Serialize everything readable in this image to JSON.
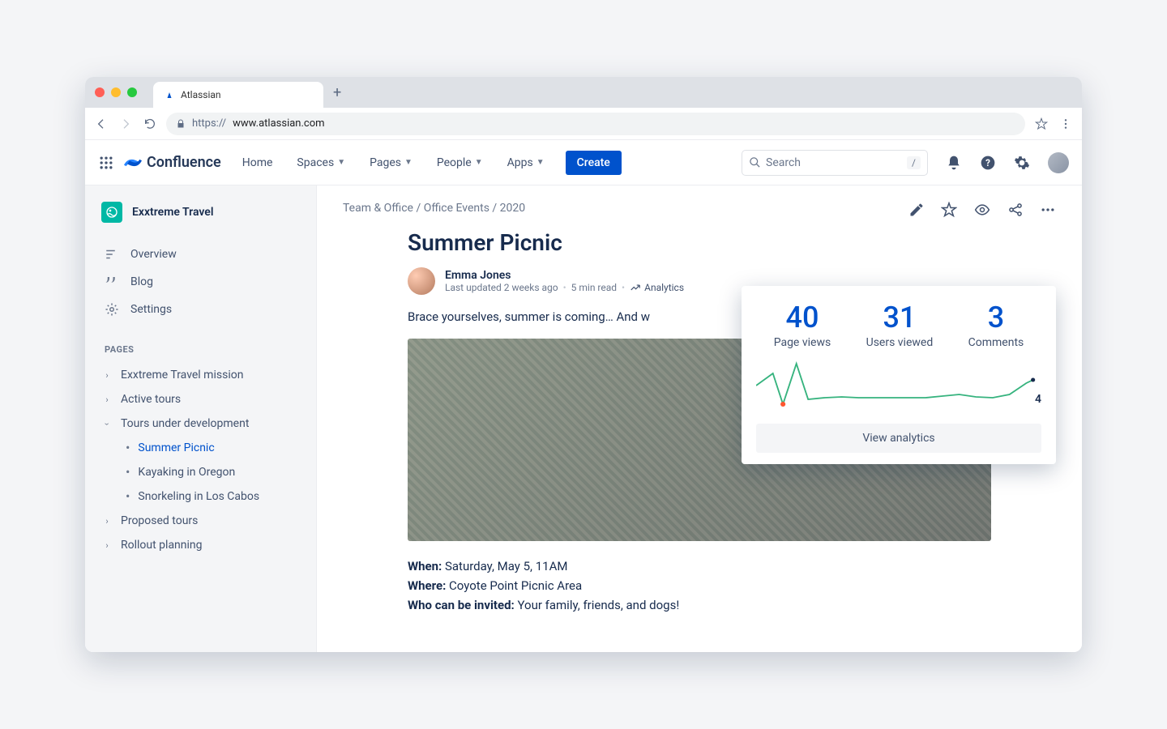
{
  "browser": {
    "tab_title": "Atlassian",
    "url_prefix": "https:// ",
    "url_domain": "www.atlassian.com"
  },
  "header": {
    "product": "Confluence",
    "nav": {
      "home": "Home",
      "spaces": "Spaces",
      "pages": "Pages",
      "people": "People",
      "apps": "Apps"
    },
    "create": "Create",
    "search_placeholder": "Search",
    "search_key": "/"
  },
  "sidebar": {
    "space": "Exxtreme Travel",
    "links": {
      "overview": "Overview",
      "blog": "Blog",
      "settings": "Settings"
    },
    "pages_label": "PAGES",
    "tree": {
      "mission": "Exxtreme Travel mission",
      "active": "Active tours",
      "dev": "Tours under development",
      "children": {
        "summer": "Summer Picnic",
        "kayak": "Kayaking in Oregon",
        "snorkel": "Snorkeling in Los Cabos"
      },
      "proposed": "Proposed tours",
      "rollout": "Rollout planning"
    }
  },
  "page": {
    "breadcrumbs": "Team & Office / Office Events / 2020",
    "title": "Summer Picnic",
    "author": "Emma Jones",
    "updated": "Last updated 2 weeks ago",
    "read_time": "5 min read",
    "analytics_label": "Analytics",
    "intro": "Brace yourselves, summer is coming… And w",
    "when_label": "When:",
    "when_value": " Saturday, May 5, 11AM",
    "where_label": "Where:",
    "where_value": " Coyote Point Picnic Area",
    "who_label": "Who can be invited:",
    "who_value": " Your family, friends, and dogs!"
  },
  "analytics": {
    "views_num": "40",
    "views_lbl": "Page views",
    "users_num": "31",
    "users_lbl": "Users viewed",
    "comments_num": "3",
    "comments_lbl": "Comments",
    "sparkline_last": "4",
    "view_btn": "View analytics"
  },
  "chart_data": {
    "type": "line",
    "title": "Page views over time",
    "series": [
      {
        "name": "Views",
        "values": [
          28,
          40,
          4,
          55,
          8,
          10,
          11,
          10,
          10,
          10,
          10,
          12,
          14,
          11,
          10,
          14,
          22
        ]
      }
    ],
    "ylim": [
      0,
      60
    ],
    "annotations": [
      {
        "x_index": 16,
        "label": "4"
      }
    ],
    "highlight_point_index": 2
  }
}
